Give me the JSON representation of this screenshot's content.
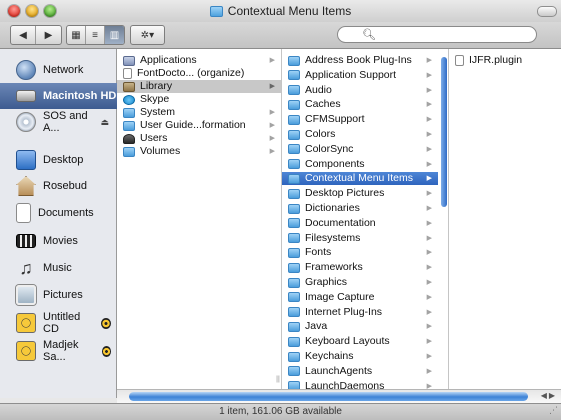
{
  "window": {
    "title": "Contextual Menu Items"
  },
  "toolbar": {
    "back_label": "◀",
    "forward_label": "▶",
    "view_icon_label": "▦",
    "view_list_label": "≡",
    "view_column_label": "▥",
    "action_label": "✲▾",
    "search_value": ""
  },
  "sidebar": {
    "items": [
      {
        "label": "Network",
        "icon": "network-icon"
      },
      {
        "label": "Macintosh HD",
        "icon": "hard-drive-icon",
        "selected": true
      },
      {
        "label": "SOS and A...",
        "icon": "cd-icon",
        "eject": "⏏"
      },
      {
        "label": "Desktop",
        "icon": "desktop-icon"
      },
      {
        "label": "Rosebud",
        "icon": "home-icon"
      },
      {
        "label": "Documents",
        "icon": "documents-icon"
      },
      {
        "label": "Movies",
        "icon": "movies-icon"
      },
      {
        "label": "Music",
        "icon": "music-icon"
      },
      {
        "label": "Pictures",
        "icon": "pictures-icon"
      },
      {
        "label": "Untitled CD",
        "icon": "burn-cd-icon",
        "burn": true
      },
      {
        "label": "Madjek Sa...",
        "icon": "burn-cd-icon",
        "burn": true
      }
    ]
  },
  "columns": {
    "col1": [
      {
        "label": "Applications",
        "kind": "app",
        "arrow": "▶"
      },
      {
        "label": "FontDocto... (organize)",
        "kind": "doc",
        "arrow": ""
      },
      {
        "label": "Library",
        "kind": "lib",
        "arrow": "▶",
        "selected": true
      },
      {
        "label": "Skype",
        "kind": "skype",
        "arrow": ""
      },
      {
        "label": "System",
        "kind": "folder",
        "arrow": "▶"
      },
      {
        "label": "User Guide...formation",
        "kind": "folder",
        "arrow": "▶"
      },
      {
        "label": "Users",
        "kind": "user",
        "arrow": "▶"
      },
      {
        "label": "Volumes",
        "kind": "folder",
        "arrow": "▶"
      }
    ],
    "col2": [
      {
        "label": "Address Book Plug-Ins",
        "arrow": "▶"
      },
      {
        "label": "Application Support",
        "arrow": "▶"
      },
      {
        "label": "Audio",
        "arrow": "▶"
      },
      {
        "label": "Caches",
        "arrow": "▶"
      },
      {
        "label": "CFMSupport",
        "arrow": "▶"
      },
      {
        "label": "Colors",
        "arrow": "▶"
      },
      {
        "label": "ColorSync",
        "arrow": "▶"
      },
      {
        "label": "Components",
        "arrow": "▶"
      },
      {
        "label": "Contextual Menu Items",
        "arrow": "▶",
        "active": true
      },
      {
        "label": "Desktop Pictures",
        "arrow": "▶"
      },
      {
        "label": "Dictionaries",
        "arrow": "▶"
      },
      {
        "label": "Documentation",
        "arrow": "▶"
      },
      {
        "label": "Filesystems",
        "arrow": "▶"
      },
      {
        "label": "Fonts",
        "arrow": "▶"
      },
      {
        "label": "Frameworks",
        "arrow": "▶"
      },
      {
        "label": "Graphics",
        "arrow": "▶"
      },
      {
        "label": "Image Capture",
        "arrow": "▶"
      },
      {
        "label": "Internet Plug-Ins",
        "arrow": "▶"
      },
      {
        "label": "Java",
        "arrow": "▶"
      },
      {
        "label": "Keyboard Layouts",
        "arrow": "▶"
      },
      {
        "label": "Keychains",
        "arrow": "▶"
      },
      {
        "label": "LaunchAgents",
        "arrow": "▶"
      },
      {
        "label": "LaunchDaemons",
        "arrow": "▶"
      }
    ],
    "col3": [
      {
        "label": "IJFR.plugin",
        "kind": "doc",
        "arrow": ""
      }
    ]
  },
  "status": {
    "text": "1 item, 161.06 GB available"
  },
  "colors": {
    "selection_blue": "#2e64bd",
    "folder_blue": "#4a9ddb",
    "sidebar_bg": "#e7e9ee"
  }
}
